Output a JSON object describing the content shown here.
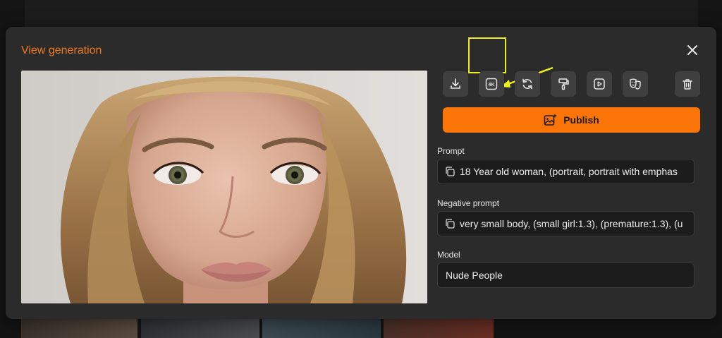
{
  "modal": {
    "title": "View generation"
  },
  "toolbar": {
    "buttons": [
      {
        "name": "download",
        "icon": "download-icon"
      },
      {
        "name": "upscale-4k",
        "icon": "4k-icon",
        "label": "4K"
      },
      {
        "name": "regenerate",
        "icon": "refresh-icon"
      },
      {
        "name": "paint",
        "icon": "paint-roller-icon"
      },
      {
        "name": "video",
        "icon": "play-icon"
      },
      {
        "name": "face",
        "icon": "masks-icon"
      },
      {
        "name": "delete",
        "icon": "trash-icon"
      }
    ]
  },
  "publish": {
    "label": "Publish",
    "icon": "image-sparkle-icon"
  },
  "prompt": {
    "label": "Prompt",
    "value": "18 Year old woman, (portrait, portrait with emphas"
  },
  "negative_prompt": {
    "label": "Negative prompt",
    "value": "very small body, (small girl:1.3), (premature:1.3), (u"
  },
  "model": {
    "label": "Model",
    "value": "Nude People"
  },
  "colors": {
    "accent": "#f27a1a",
    "publish_bg": "#fb7408",
    "modal_bg": "#2b2b2b",
    "field_bg": "#1c1c1c",
    "annotation": "#ecf01a"
  }
}
